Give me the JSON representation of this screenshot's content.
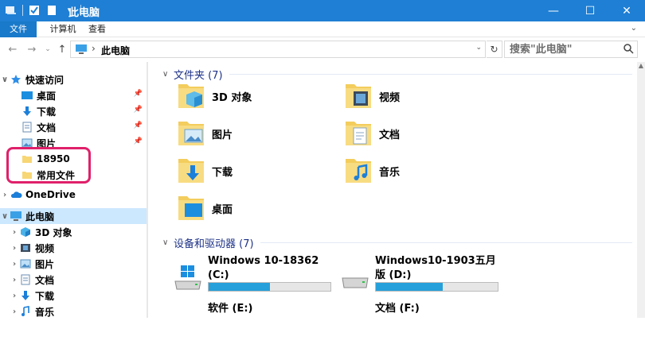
{
  "window": {
    "title": "此电脑"
  },
  "ribbon": {
    "tabs": [
      "文件",
      "计算机",
      "查看"
    ]
  },
  "address": {
    "crumb": "此电脑"
  },
  "search": {
    "placeholder": "搜索\"此电脑\""
  },
  "nav": {
    "items": [
      {
        "label": "快速访问",
        "icon": "star-icon"
      },
      {
        "label": "桌面",
        "icon": "desktop-icon"
      },
      {
        "label": "下载",
        "icon": "download-icon"
      },
      {
        "label": "文档",
        "icon": "document-icon"
      },
      {
        "label": "图片",
        "icon": "picture-icon"
      },
      {
        "label": "18950",
        "icon": "folder-icon"
      },
      {
        "label": "常用文件",
        "icon": "folder-icon"
      },
      {
        "label": "OneDrive",
        "icon": "cloud-icon"
      },
      {
        "label": "此电脑",
        "icon": "computer-icon"
      },
      {
        "label": "3D 对象",
        "icon": "cube-icon"
      },
      {
        "label": "视频",
        "icon": "video-icon"
      },
      {
        "label": "图片",
        "icon": "picture-icon"
      },
      {
        "label": "文档",
        "icon": "document-icon"
      },
      {
        "label": "下载",
        "icon": "download-icon"
      },
      {
        "label": "音乐",
        "icon": "music-icon"
      }
    ]
  },
  "content": {
    "folders_header": "文件夹 (7)",
    "folders": [
      "3D 对象",
      "视频",
      "图片",
      "文档",
      "下载",
      "音乐",
      "桌面"
    ],
    "devices_header": "设备和驱动器 (7)",
    "drives": [
      {
        "name": "Windows 10-18362",
        "letter": "(C:)",
        "fill": 0.5
      },
      {
        "name": "Windows10-1903五月",
        "letter": "版 (D:)",
        "fill": 0.55
      },
      {
        "name": "软件 (E:)",
        "letter": "",
        "fill": 0
      },
      {
        "name": "文档 (F:)",
        "letter": "",
        "fill": 0
      }
    ]
  },
  "colors": {
    "titlebar": "#1e7fd4",
    "accent": "#26a0da",
    "highlight": "#e0206a",
    "selected": "#cce8ff"
  }
}
